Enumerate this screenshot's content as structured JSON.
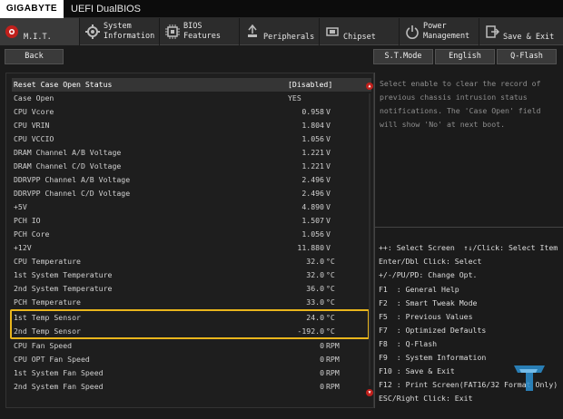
{
  "titlebar": {
    "brand": "GIGABYTE",
    "title": "UEFI DualBIOS"
  },
  "tabs": [
    {
      "label": "M.I.T.",
      "icon": "mit-icon",
      "active": true
    },
    {
      "label": "System\nInformation",
      "icon": "system-info-icon",
      "active": false
    },
    {
      "label": "BIOS\nFeatures",
      "icon": "bios-features-icon",
      "active": false
    },
    {
      "label": "Peripherals",
      "icon": "peripherals-icon",
      "active": false
    },
    {
      "label": "Chipset",
      "icon": "chipset-icon",
      "active": false
    },
    {
      "label": "Power\nManagement",
      "icon": "power-icon",
      "active": false
    },
    {
      "label": "Save & Exit",
      "icon": "save-exit-icon",
      "active": false
    }
  ],
  "funcbar": {
    "back": "Back",
    "st_mode": "S.T.Mode",
    "language": "English",
    "qflash": "Q-Flash"
  },
  "rows": [
    {
      "label": "Reset Case Open Status",
      "text": "[Disabled]"
    },
    {
      "label": "Case Open",
      "text": "YES"
    },
    {
      "label": "CPU Vcore",
      "value": "0.958",
      "unit": "V"
    },
    {
      "label": "CPU VRIN",
      "value": "1.804",
      "unit": "V"
    },
    {
      "label": "CPU VCCIO",
      "value": "1.056",
      "unit": "V"
    },
    {
      "label": "DRAM Channel A/B Voltage",
      "value": "1.221",
      "unit": "V"
    },
    {
      "label": "DRAM Channel C/D Voltage",
      "value": "1.221",
      "unit": "V"
    },
    {
      "label": "DDRVPP Channel A/B Voltage",
      "value": "2.496",
      "unit": "V"
    },
    {
      "label": "DDRVPP Channel C/D Voltage",
      "value": "2.496",
      "unit": "V"
    },
    {
      "label": "+5V",
      "value": "4.890",
      "unit": "V"
    },
    {
      "label": "PCH IO",
      "value": "1.507",
      "unit": "V"
    },
    {
      "label": "PCH Core",
      "value": "1.056",
      "unit": "V"
    },
    {
      "label": "+12V",
      "value": "11.880",
      "unit": "V"
    },
    {
      "label": "CPU Temperature",
      "value": "32.0",
      "unit": "°C"
    },
    {
      "label": "1st System Temperature",
      "value": "32.0",
      "unit": "°C"
    },
    {
      "label": "2nd System Temperature",
      "value": "36.0",
      "unit": "°C"
    },
    {
      "label": "PCH Temperature",
      "value": "33.0",
      "unit": "°C"
    },
    {
      "label": "1st Temp Sensor",
      "value": "24.0",
      "unit": "°C"
    },
    {
      "label": "2nd Temp Sensor",
      "value": "-192.0",
      "unit": "°C"
    },
    {
      "label": "CPU Fan Speed",
      "value": "0",
      "unit": "RPM"
    },
    {
      "label": "CPU OPT Fan Speed",
      "value": "0",
      "unit": "RPM"
    },
    {
      "label": "1st System Fan Speed",
      "value": "0",
      "unit": "RPM"
    },
    {
      "label": "2nd System Fan Speed",
      "value": "0",
      "unit": "RPM"
    }
  ],
  "help": {
    "text": "Select enable to clear the record of previous chassis intrusion status notifications. The 'Case Open' field will show 'No' at next boot."
  },
  "keys": [
    "++: Select Screen  ↑↓/Click: Select Item",
    "Enter/Dbl Click: Select",
    "+/-/PU/PD: Change Opt.",
    "F1  : General Help",
    "F2  : Smart Tweak Mode",
    "F5  : Previous Values",
    "F7  : Optimized Defaults",
    "F8  : Q-Flash",
    "F9  : System Information",
    "F10 : Save & Exit",
    "F12 : Print Screen(FAT16/32 Format Only)",
    "ESC/Right Click: Exit"
  ],
  "colors": {
    "highlight": "#e9b51c",
    "accent_red": "#c0201c"
  }
}
